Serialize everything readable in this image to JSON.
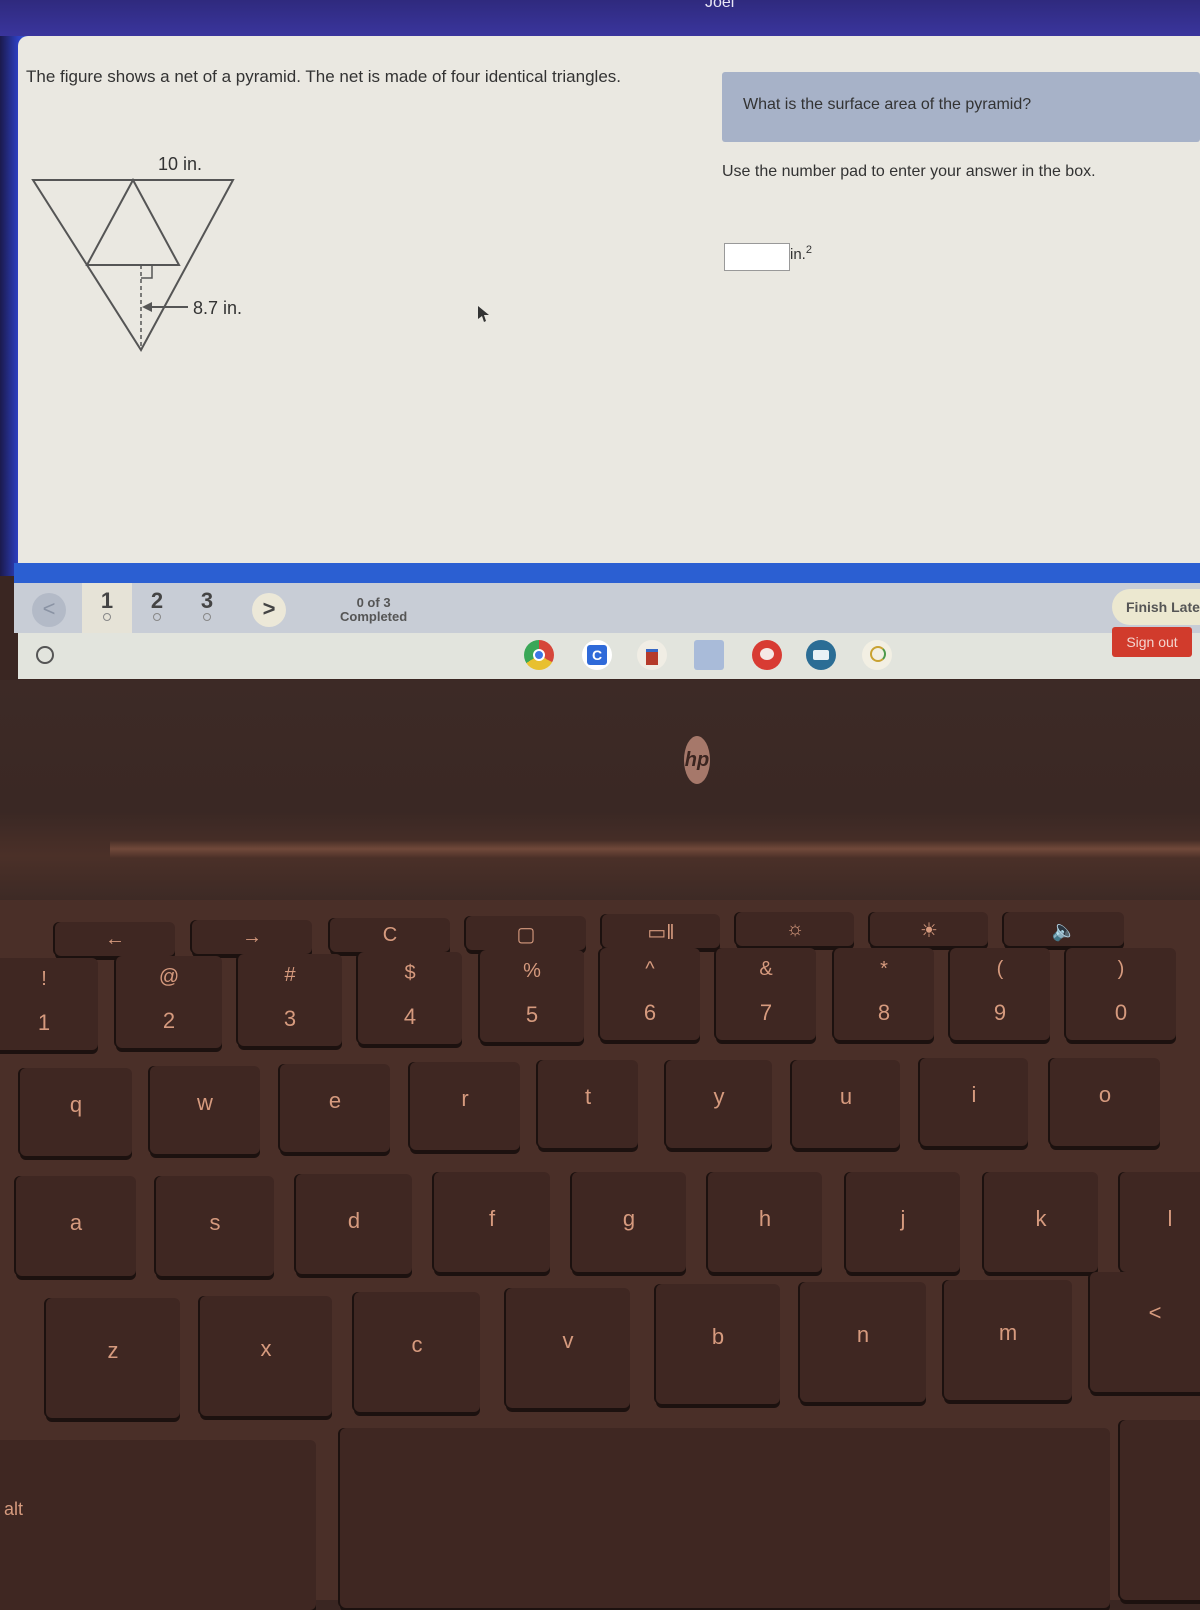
{
  "header": {
    "user_name": "Joel"
  },
  "question": {
    "prompt": "The figure shows a net of a pyramid. The net is made of four identical triangles.",
    "figure": {
      "side_label": "10 in.",
      "height_label": "8.7 in."
    },
    "title": "What is the surface area of the pyramid?",
    "instruction": "Use the number pad to enter your answer in the box.",
    "answer_value": "",
    "unit": "in.",
    "unit_exponent": "2"
  },
  "navigation": {
    "prev_symbol": "<",
    "next_symbol": ">",
    "pages": [
      "1",
      "2",
      "3"
    ],
    "active_page": "1",
    "progress_count": "0 of 3",
    "progress_label": "Completed",
    "finish_later": "Finish Later"
  },
  "shelf": {
    "apps": [
      "chrome-icon",
      "classroom-c-icon",
      "books-app-icon",
      "blank-app-icon",
      "paint-palette-icon",
      "news-card-icon",
      "cloud-app-icon"
    ],
    "sign_out": "Sign out"
  },
  "laptop": {
    "brand": "hp"
  },
  "keyboard": {
    "function_row": [
      "←",
      "→",
      "C",
      "▢",
      "▭ǁ",
      "☼",
      "☀",
      "🔈"
    ],
    "number_row": [
      {
        "shift": "!",
        "main": "1"
      },
      {
        "shift": "@",
        "main": "2"
      },
      {
        "shift": "#",
        "main": "3"
      },
      {
        "shift": "$",
        "main": "4"
      },
      {
        "shift": "%",
        "main": "5"
      },
      {
        "shift": "^",
        "main": "6"
      },
      {
        "shift": "&",
        "main": "7"
      },
      {
        "shift": "*",
        "main": "8"
      },
      {
        "shift": "(",
        "main": "9"
      },
      {
        "shift": ")",
        "main": "0"
      }
    ],
    "row_q": [
      "q",
      "w",
      "e",
      "r",
      "t",
      "y",
      "u",
      "i",
      "o"
    ],
    "row_a": [
      "a",
      "s",
      "d",
      "f",
      "g",
      "h",
      "j",
      "k",
      "l"
    ],
    "row_z": [
      "z",
      "x",
      "c",
      "v",
      "b",
      "n",
      "m",
      "<"
    ],
    "alt_label": "alt"
  }
}
